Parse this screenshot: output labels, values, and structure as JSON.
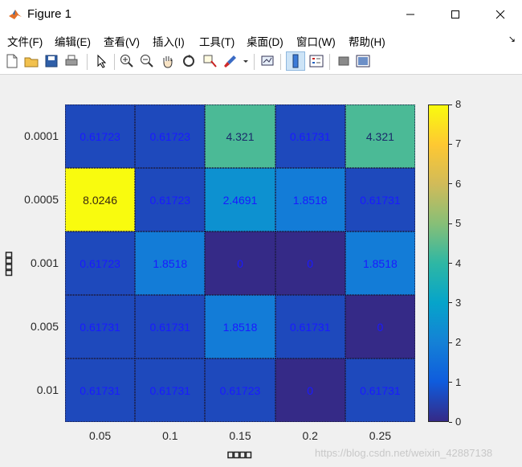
{
  "window": {
    "title": "Figure 1"
  },
  "menu": [
    "文件(F)",
    "编辑(E)",
    "查看(V)",
    "插入(I)",
    "工具(T)",
    "桌面(D)",
    "窗口(W)",
    "帮助(H)"
  ],
  "toolbar_icons": [
    "new-figure-icon",
    "open-file-icon",
    "save-icon",
    "print-icon",
    "pointer-icon",
    "zoom-in-icon",
    "zoom-out-icon",
    "pan-icon",
    "rotate-3d-icon",
    "data-cursor-icon",
    "brush-icon",
    "brush-dropdown-icon",
    "link-plot-icon",
    "colorbar-icon",
    "legend-icon",
    "hide-plot-tools-icon",
    "show-plot-tools-icon"
  ],
  "chart_data": {
    "type": "heatmap",
    "x_categories": [
      "0.05",
      "0.1",
      "0.15",
      "0.2",
      "0.25"
    ],
    "y_categories": [
      "0.0001",
      "0.0005",
      "0.001",
      "0.005",
      "0.01"
    ],
    "values": [
      [
        0.61723,
        0.61723,
        4.321,
        0.61731,
        4.321
      ],
      [
        8.0246,
        0.61723,
        2.4691,
        1.8518,
        0.61731
      ],
      [
        0.61723,
        1.8518,
        0,
        0,
        1.8518
      ],
      [
        0.61731,
        0.61731,
        1.8518,
        0.61731,
        0
      ],
      [
        0.61731,
        0.61731,
        0.61723,
        0,
        0.61731
      ]
    ],
    "cell_labels": [
      [
        "0.61723",
        "0.61723",
        "4.321",
        "0.61731",
        "4.321"
      ],
      [
        "8.0246",
        "0.61723",
        "2.4691",
        "1.8518",
        "0.61731"
      ],
      [
        "0.61723",
        "1.8518",
        "0",
        "0",
        "1.8518"
      ],
      [
        "0.61731",
        "0.61731",
        "1.8518",
        "0.61731",
        "0"
      ],
      [
        "0.61731",
        "0.61731",
        "0.61723",
        "0",
        "0.61731"
      ]
    ],
    "colorbar": {
      "min": 0,
      "max": 8,
      "ticks": [
        "0",
        "1",
        "2",
        "3",
        "4",
        "5",
        "6",
        "7",
        "8"
      ]
    },
    "colormap": "parula",
    "xlabel_glyphs": 4,
    "ylabel_glyphs": 4,
    "grid": true,
    "legend": "none"
  },
  "watermark": "https://blog.csdn.net/weixin_42887138",
  "colors": {
    "cell_text": "#1a1aff",
    "axis_text": "#262626"
  }
}
